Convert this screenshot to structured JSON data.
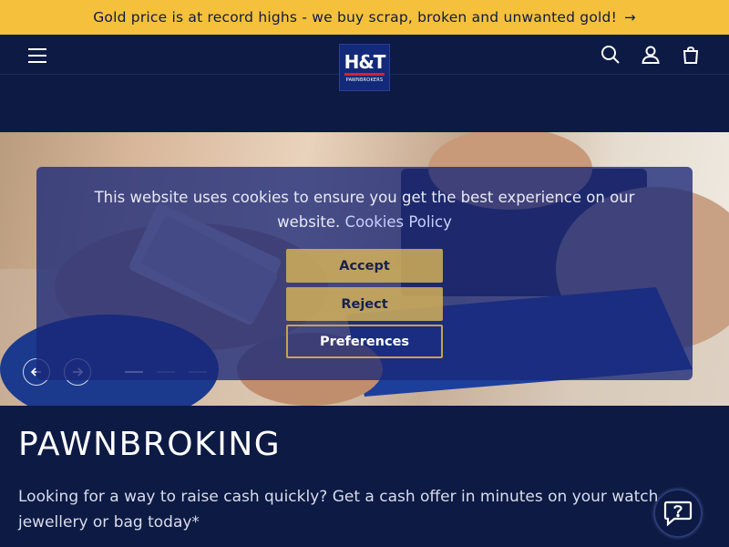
{
  "announcement": {
    "text": "Gold price is at record highs - we buy scrap, broken and unwanted gold!",
    "arrow": "→"
  },
  "header": {
    "logo": {
      "mark": "H&T",
      "sub": "PAWNBROKERS"
    },
    "icons": [
      "menu-icon",
      "search-icon",
      "account-icon",
      "cart-icon"
    ]
  },
  "cookie_banner": {
    "text": "This website uses cookies to ensure you get the best experience on our website.",
    "policy_link": "Cookies Policy",
    "accept": "Accept",
    "reject": "Reject",
    "preferences": "Preferences"
  },
  "slider": {
    "slide_count": 3,
    "active_index": 0
  },
  "main": {
    "headline": "PAWNBROKING",
    "intro": "Looking for a way to raise cash quickly? Get a cash offer in minutes on your watch, jewellery or bag today*"
  },
  "colors": {
    "navy": "#0c1a44",
    "gold": "#f5c03b",
    "banner_blue": "#1a2878"
  }
}
